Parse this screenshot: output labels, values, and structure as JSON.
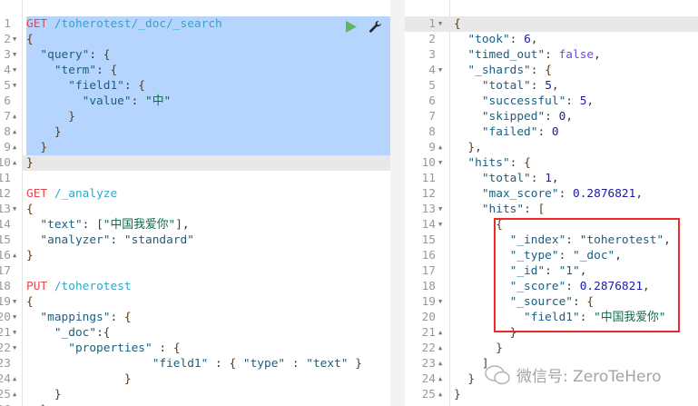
{
  "request_editor": {
    "run_label": "Run request",
    "settings_label": "Request options",
    "lines": [
      [
        [
          "method",
          "GET"
        ],
        [
          "punc",
          " "
        ],
        [
          "url",
          "/toherotest/_doc/_search"
        ]
      ],
      [
        [
          "brace",
          "{"
        ]
      ],
      [
        [
          "punc",
          "  "
        ],
        [
          "key",
          "\"query\""
        ],
        [
          "punc",
          ": "
        ],
        [
          "brace",
          "{"
        ]
      ],
      [
        [
          "punc",
          "    "
        ],
        [
          "key",
          "\"term\""
        ],
        [
          "punc",
          ": "
        ],
        [
          "brace",
          "{"
        ]
      ],
      [
        [
          "punc",
          "      "
        ],
        [
          "key",
          "\"field1\""
        ],
        [
          "punc",
          ": "
        ],
        [
          "brace",
          "{"
        ]
      ],
      [
        [
          "punc",
          "        "
        ],
        [
          "key",
          "\"value\""
        ],
        [
          "punc",
          ": "
        ],
        [
          "cjk",
          "\"中\""
        ]
      ],
      [
        [
          "punc",
          "      "
        ],
        [
          "brace",
          "}"
        ]
      ],
      [
        [
          "punc",
          "    "
        ],
        [
          "brace",
          "}"
        ]
      ],
      [
        [
          "punc",
          "  "
        ],
        [
          "brace",
          "}"
        ]
      ],
      [
        [
          "brace",
          "}"
        ]
      ],
      [],
      [
        [
          "method",
          "GET"
        ],
        [
          "punc",
          " "
        ],
        [
          "url",
          "/_analyze"
        ]
      ],
      [
        [
          "brace",
          "{"
        ]
      ],
      [
        [
          "punc",
          "  "
        ],
        [
          "key",
          "\"text\""
        ],
        [
          "punc",
          ": "
        ],
        [
          "brace",
          "["
        ],
        [
          "cjk",
          "\"中国我爱你\""
        ],
        [
          "brace",
          "]"
        ],
        [
          "punc",
          ","
        ]
      ],
      [
        [
          "punc",
          "  "
        ],
        [
          "key",
          "\"analyzer\""
        ],
        [
          "punc",
          ": "
        ],
        [
          "str",
          "\"standard\""
        ]
      ],
      [
        [
          "brace",
          "}"
        ]
      ],
      [],
      [
        [
          "method",
          "PUT"
        ],
        [
          "punc",
          " "
        ],
        [
          "url",
          "/toherotest"
        ]
      ],
      [
        [
          "brace",
          "{"
        ]
      ],
      [
        [
          "punc",
          "  "
        ],
        [
          "key",
          "\"mappings\""
        ],
        [
          "punc",
          ": "
        ],
        [
          "brace",
          "{"
        ]
      ],
      [
        [
          "punc",
          "    "
        ],
        [
          "key",
          "\"_doc\""
        ],
        [
          "punc",
          ":"
        ],
        [
          "brace",
          "{"
        ]
      ],
      [
        [
          "punc",
          "      "
        ],
        [
          "key",
          "\"properties\""
        ],
        [
          "punc",
          " : "
        ],
        [
          "brace",
          "{"
        ]
      ],
      [
        [
          "punc",
          "                  "
        ],
        [
          "key",
          "\"field1\""
        ],
        [
          "punc",
          " : "
        ],
        [
          "brace",
          "{"
        ],
        [
          "punc",
          " "
        ],
        [
          "key",
          "\"type\""
        ],
        [
          "punc",
          " : "
        ],
        [
          "str",
          "\"text\""
        ],
        [
          "punc",
          " "
        ],
        [
          "brace",
          "}"
        ]
      ],
      [
        [
          "punc",
          "              "
        ],
        [
          "brace",
          "}"
        ]
      ],
      [
        [
          "punc",
          "    "
        ],
        [
          "brace",
          "}"
        ]
      ],
      [
        [
          "punc",
          "  "
        ],
        [
          "brace",
          "}"
        ]
      ]
    ],
    "folds": [
      "",
      "down",
      "down",
      "down",
      "down",
      "",
      "up",
      "up",
      "up",
      "up",
      "",
      "",
      "down",
      "",
      "",
      "up",
      "",
      "",
      "down",
      "down",
      "down",
      "down",
      "",
      "up",
      "up",
      ""
    ]
  },
  "response_viewer": {
    "lines": [
      [
        [
          "brace",
          "{"
        ]
      ],
      [
        [
          "punc",
          "  "
        ],
        [
          "key",
          "\"took\""
        ],
        [
          "punc",
          ": "
        ],
        [
          "num",
          "6"
        ],
        [
          "punc",
          ","
        ]
      ],
      [
        [
          "punc",
          "  "
        ],
        [
          "key",
          "\"timed_out\""
        ],
        [
          "punc",
          ": "
        ],
        [
          "bool",
          "false"
        ],
        [
          "punc",
          ","
        ]
      ],
      [
        [
          "punc",
          "  "
        ],
        [
          "key",
          "\"_shards\""
        ],
        [
          "punc",
          ": "
        ],
        [
          "brace",
          "{"
        ]
      ],
      [
        [
          "punc",
          "    "
        ],
        [
          "key",
          "\"total\""
        ],
        [
          "punc",
          ": "
        ],
        [
          "num",
          "5"
        ],
        [
          "punc",
          ","
        ]
      ],
      [
        [
          "punc",
          "    "
        ],
        [
          "key",
          "\"successful\""
        ],
        [
          "punc",
          ": "
        ],
        [
          "num",
          "5"
        ],
        [
          "punc",
          ","
        ]
      ],
      [
        [
          "punc",
          "    "
        ],
        [
          "key",
          "\"skipped\""
        ],
        [
          "punc",
          ": "
        ],
        [
          "num",
          "0"
        ],
        [
          "punc",
          ","
        ]
      ],
      [
        [
          "punc",
          "    "
        ],
        [
          "key",
          "\"failed\""
        ],
        [
          "punc",
          ": "
        ],
        [
          "num",
          "0"
        ]
      ],
      [
        [
          "punc",
          "  "
        ],
        [
          "brace",
          "}"
        ],
        [
          "punc",
          ","
        ]
      ],
      [
        [
          "punc",
          "  "
        ],
        [
          "key",
          "\"hits\""
        ],
        [
          "punc",
          ": "
        ],
        [
          "brace",
          "{"
        ]
      ],
      [
        [
          "punc",
          "    "
        ],
        [
          "key",
          "\"total\""
        ],
        [
          "punc",
          ": "
        ],
        [
          "num",
          "1"
        ],
        [
          "punc",
          ","
        ]
      ],
      [
        [
          "punc",
          "    "
        ],
        [
          "key",
          "\"max_score\""
        ],
        [
          "punc",
          ": "
        ],
        [
          "num",
          "0.2876821"
        ],
        [
          "punc",
          ","
        ]
      ],
      [
        [
          "punc",
          "    "
        ],
        [
          "key",
          "\"hits\""
        ],
        [
          "punc",
          ": "
        ],
        [
          "brace",
          "["
        ]
      ],
      [
        [
          "punc",
          "      "
        ],
        [
          "brace",
          "{"
        ]
      ],
      [
        [
          "punc",
          "        "
        ],
        [
          "key",
          "\"_index\""
        ],
        [
          "punc",
          ": "
        ],
        [
          "str",
          "\"toherotest\""
        ],
        [
          "punc",
          ","
        ]
      ],
      [
        [
          "punc",
          "        "
        ],
        [
          "key",
          "\"_type\""
        ],
        [
          "punc",
          ": "
        ],
        [
          "str",
          "\"_doc\""
        ],
        [
          "punc",
          ","
        ]
      ],
      [
        [
          "punc",
          "        "
        ],
        [
          "key",
          "\"_id\""
        ],
        [
          "punc",
          ": "
        ],
        [
          "str",
          "\"1\""
        ],
        [
          "punc",
          ","
        ]
      ],
      [
        [
          "punc",
          "        "
        ],
        [
          "key",
          "\"_score\""
        ],
        [
          "punc",
          ": "
        ],
        [
          "num",
          "0.2876821"
        ],
        [
          "punc",
          ","
        ]
      ],
      [
        [
          "punc",
          "        "
        ],
        [
          "key",
          "\"_source\""
        ],
        [
          "punc",
          ": "
        ],
        [
          "brace",
          "{"
        ]
      ],
      [
        [
          "punc",
          "          "
        ],
        [
          "key",
          "\"field1\""
        ],
        [
          "punc",
          ": "
        ],
        [
          "cjk",
          "\"中国我爱你\""
        ]
      ],
      [
        [
          "punc",
          "        "
        ],
        [
          "brace",
          "}"
        ]
      ],
      [
        [
          "punc",
          "      "
        ],
        [
          "brace",
          "}"
        ]
      ],
      [
        [
          "punc",
          "    "
        ],
        [
          "brace",
          "]"
        ]
      ],
      [
        [
          "punc",
          "  "
        ],
        [
          "brace",
          "}"
        ]
      ],
      [
        [
          "brace",
          "}"
        ]
      ]
    ],
    "folds": [
      "down",
      "",
      "",
      "down",
      "",
      "",
      "",
      "",
      "up",
      "down",
      "",
      "",
      "down",
      "down",
      "",
      "",
      "",
      "",
      "down",
      "",
      "up",
      "up",
      "up",
      "up",
      "up"
    ]
  },
  "watermark": "微信号: ZeroTeHero",
  "colors": {
    "selection": "#b5d5ff",
    "highlight_box": "#ec2a2a",
    "run_button": "#5cb85c"
  }
}
